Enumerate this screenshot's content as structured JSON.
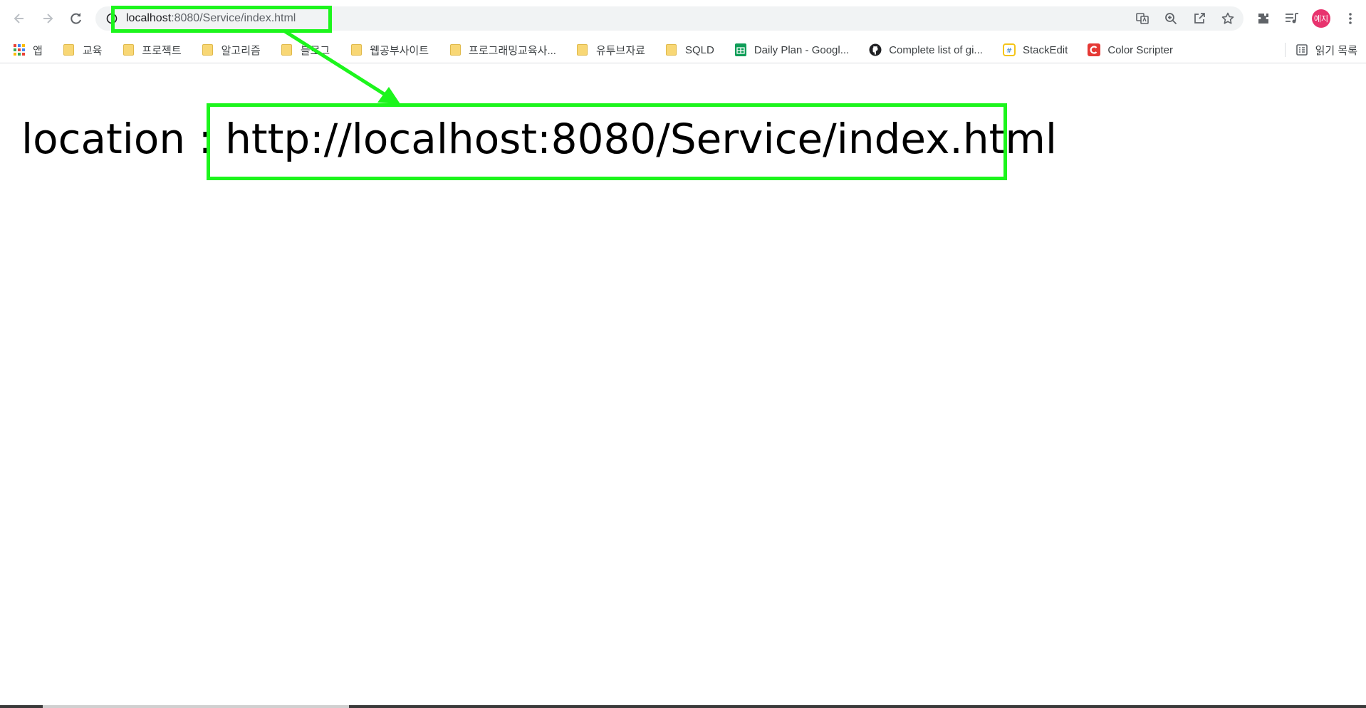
{
  "browser": {
    "url_host": "localhost",
    "url_path": ":8080/Service/index.html",
    "avatar_text": "예지"
  },
  "bookmarks": [
    {
      "label": "앱",
      "icon": "apps-icon"
    },
    {
      "label": "교육",
      "icon": "folder-icon"
    },
    {
      "label": "프로젝트",
      "icon": "folder-icon"
    },
    {
      "label": "알고리즘",
      "icon": "folder-icon"
    },
    {
      "label": "블로그",
      "icon": "folder-icon"
    },
    {
      "label": "웹공부사이트",
      "icon": "folder-icon"
    },
    {
      "label": "프로그래밍교육사...",
      "icon": "folder-icon"
    },
    {
      "label": "유투브자료",
      "icon": "folder-icon"
    },
    {
      "label": "SQLD",
      "icon": "folder-icon"
    },
    {
      "label": "Daily Plan - Googl...",
      "icon": "google-sheets-icon"
    },
    {
      "label": "Complete list of gi...",
      "icon": "github-icon"
    },
    {
      "label": "StackEdit",
      "icon": "stackedit-icon"
    },
    {
      "label": "Color Scripter",
      "icon": "color-scripter-icon"
    }
  ],
  "reading_list_label": "읽기 목록",
  "page": {
    "label": "location :",
    "value": "http://localhost:8080/Service/index.html"
  },
  "colors": {
    "highlight": "#1cf51c",
    "avatar": "#e8336e"
  }
}
